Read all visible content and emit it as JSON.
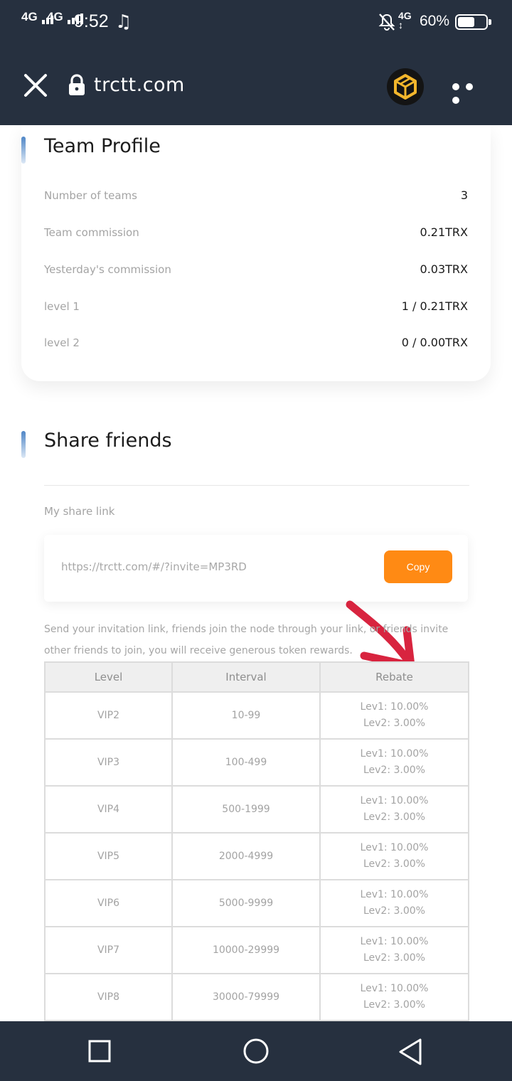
{
  "status_bar": {
    "sim1": "4G",
    "sim2": "4G",
    "time": "9:52",
    "network": "4G",
    "battery": "60%",
    "battery_level": 0.6
  },
  "browser": {
    "url": "trctt.com",
    "close_icon": "close-icon",
    "lock_icon": "lock-icon",
    "menu_icon": "more-dots-icon"
  },
  "team_profile": {
    "title": "Team Profile",
    "rows": [
      {
        "label": "Number of teams",
        "value": "3"
      },
      {
        "label": "Team commission",
        "value": "0.21TRX"
      },
      {
        "label": "Yesterday's commission",
        "value": "0.03TRX"
      },
      {
        "label": "level 1",
        "value": "1 / 0.21TRX"
      },
      {
        "label": "level 2",
        "value": "0 / 0.00TRX"
      }
    ]
  },
  "share": {
    "title": "Share friends",
    "link_label": "My share link",
    "link": "https://trctt.com/#/?invite=MP3RD",
    "copy_label": "Copy",
    "description": "Send your invitation link, friends join the node through your link, or friends invite other friends to join, you will receive generous token rewards."
  },
  "rebate_table": {
    "headers": [
      "Level",
      "Interval",
      "Rebate"
    ],
    "rows": [
      {
        "level": "VIP2",
        "interval": "10-99",
        "lev1": "Lev1: 10.00%",
        "lev2": "Lev2: 3.00%"
      },
      {
        "level": "VIP3",
        "interval": "100-499",
        "lev1": "Lev1: 10.00%",
        "lev2": "Lev2: 3.00%"
      },
      {
        "level": "VIP4",
        "interval": "500-1999",
        "lev1": "Lev1: 10.00%",
        "lev2": "Lev2: 3.00%"
      },
      {
        "level": "VIP5",
        "interval": "2000-4999",
        "lev1": "Lev1: 10.00%",
        "lev2": "Lev2: 3.00%"
      },
      {
        "level": "VIP6",
        "interval": "5000-9999",
        "lev1": "Lev1: 10.00%",
        "lev2": "Lev2: 3.00%"
      },
      {
        "level": "VIP7",
        "interval": "10000-29999",
        "lev1": "Lev1: 10.00%",
        "lev2": "Lev2: 3.00%"
      },
      {
        "level": "VIP8",
        "interval": "30000-79999",
        "lev1": "Lev1: 10.00%",
        "lev2": "Lev2: 3.00%"
      }
    ]
  },
  "colors": {
    "header_bg": "#26303f",
    "copy_button": "#ff8a14",
    "annotation_arrow": "#d8243f",
    "accent": "#4f86c6"
  },
  "nav": {
    "recent_icon": "square-recents-icon",
    "home_icon": "circle-home-icon",
    "back_icon": "triangle-back-icon"
  }
}
